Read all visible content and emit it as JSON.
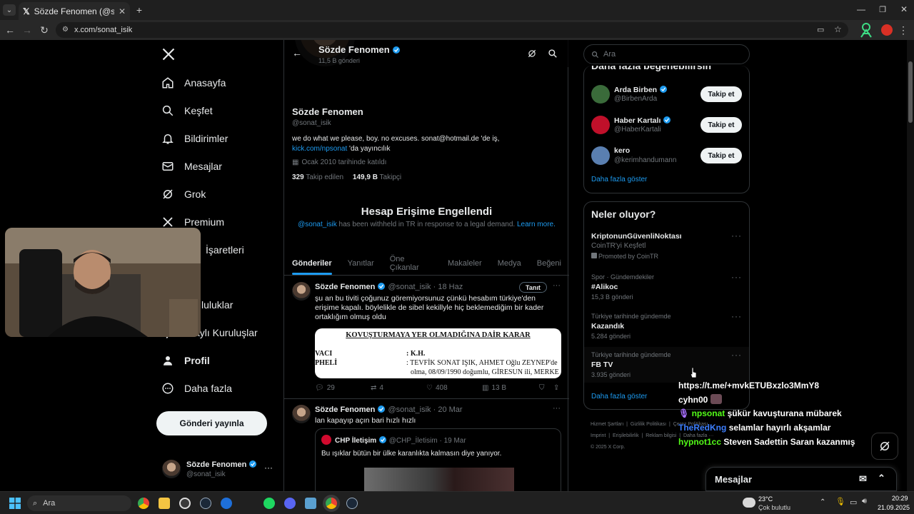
{
  "browser": {
    "tab_title": "Sözde Fenomen (@sonat_isik) /",
    "url": "x.com/sonat_isik"
  },
  "nav": {
    "items": [
      {
        "label": "Anasayfa",
        "icon": "home-icon"
      },
      {
        "label": "Keşfet",
        "icon": "search-icon"
      },
      {
        "label": "Bildirimler",
        "icon": "bell-icon"
      },
      {
        "label": "Mesajlar",
        "icon": "mail-icon"
      },
      {
        "label": "Grok",
        "icon": "grok-icon"
      },
      {
        "label": "Premium",
        "icon": "x-logo-icon"
      },
      {
        "label": "İşaretleri",
        "icon": "bookmark-icon"
      },
      {
        "label": "luluklar",
        "icon": "community-icon"
      },
      {
        "label": "aylı Kuruluşlar",
        "icon": "lightning-icon"
      },
      {
        "label": "Profil",
        "icon": "person-icon"
      },
      {
        "label": "Daha fazla",
        "icon": "more-circle-icon"
      }
    ],
    "post_button": "Gönderi yayınla",
    "account_name": "Sözde Fenomen",
    "account_handle": "@sonat_isik",
    "account_more": "···"
  },
  "profile": {
    "header_name": "Sözde Fenomen",
    "header_posts": "11,5 B gönderi",
    "name": "Sözde Fenomen",
    "handle": "@sonat_isik",
    "bio_line1": "we do what we please, boy. no excuses.  sonat@hotmail.de 'de iş,",
    "bio_link": "kick.com/npsonat",
    "bio_line2_rest": " 'da yayıncılık",
    "joined": "Ocak 2010 tarihinde katıldı",
    "following_count": "329",
    "following_label": "Takip edilen",
    "followers_count": "149,9 B",
    "followers_label": "Takipçi",
    "withheld_title": "Hesap Erişime Engellendi",
    "withheld_handle": "@sonat_isik",
    "withheld_text": " has been withheld in TR in response to a legal demand. ",
    "withheld_link": "Learn more."
  },
  "tabs": [
    "Gönderiler",
    "Yanıtlar",
    "Öne Çıkanlar",
    "Makaleler",
    "Medya",
    "Beğeni"
  ],
  "tweets": [
    {
      "name": "Sözde Fenomen",
      "handle": "@sonat_isik",
      "date": "· 18 Haz",
      "translate": "Tanıt",
      "more": "···",
      "text": "şu an bu tiviti çoğunuz göremiyorsunuz çünkü hesabım türkiye'den erişime kapalı. böylelikle de sibel kekillyle hiç beklemediğim bir kader ortaklığım olmuş oldu",
      "doc_title": "KOVUŞTURMAYA YER OLMADIĞINA DAİR KARAR",
      "doc_row1_label": "VACI",
      "doc_row1_value": ": K.H.",
      "doc_row2_label": "PHELİ",
      "doc_row2_value": ": TEVFİK SONAT IŞIK, AHMET Oğlu ZEYNEP'de",
      "doc_row3_value": "olma, 08/09/1990 doğumlu, GİRESUN ili, MERKE",
      "replies": "29",
      "reposts": "4",
      "likes": "408",
      "views": "13 B"
    },
    {
      "name": "Sözde Fenomen",
      "handle": "@sonat_isik",
      "date": "· 20 Mar",
      "more": "···",
      "text": "lan kapayıp açın bari hızlı hızlı",
      "quote_name": "CHP İletişim",
      "quote_handle": "@CHP_İletisim",
      "quote_date": "· 19 Mar",
      "quote_text": "Bu ışıklar bütün bir ülke karanlıkta kalmasın diye yanıyor."
    }
  ],
  "right": {
    "search_placeholder": "Ara",
    "who_title": "Daha fazla beğenebilirsin",
    "suggestions": [
      {
        "name": "Arda Birben",
        "handle": "@BirbenArda",
        "button": "Takip et",
        "color": "#3a6b3a"
      },
      {
        "name": "Haber Kartalı",
        "handle": "@HaberKartali",
        "button": "Takip et",
        "color": "#c0102a"
      },
      {
        "name": "kero",
        "handle": "@kerimhandumann",
        "button": "Takip et",
        "color": "#5a7fb0"
      }
    ],
    "show_more": "Daha fazla göster",
    "trends_title": "Neler oluyor?",
    "trends": [
      {
        "name": "KriptonunGüvenliNoktası",
        "meta": "CoinTR'yi Keşfetl",
        "sub": "Promoted by CoinTR"
      },
      {
        "meta": "Spor · Gündemdekiler",
        "name": "#Alikoc",
        "sub": "15,3 B gönderi"
      },
      {
        "meta": "Türkiye tarihinde gündemde",
        "name": "Kazandık",
        "sub": "5.284 gönderi"
      },
      {
        "meta": "Türkiye tarihinde gündemde",
        "name": "FB TV",
        "sub": "3.935 gönderi"
      }
    ],
    "trends_more": "Daha fazla göster",
    "footer_line1": [
      "Hizmet Şartları",
      "Gizlilik Politikası",
      "Çerez Politikası"
    ],
    "footer_line2": [
      "Imprint",
      "Erişilebilirlik",
      "Reklam bilgisi",
      "Daha fazla ···"
    ],
    "footer_copy": "© 2025 X Corp."
  },
  "chat": [
    {
      "user": "",
      "text": "https://t.me/+mvkETUBxzlo3MmY8",
      "color": "#ffffff"
    },
    {
      "user": "cyhn00",
      "text": "",
      "color": "#ffffff"
    },
    {
      "user": "npsonat",
      "text": "şükür kavuşturana mübarek",
      "color": "#53fc18"
    },
    {
      "user": "TheRedKng",
      "text": "selamlar hayırlı akşamlar",
      "color": "#3d7fff"
    },
    {
      "user": "hypnot1cc",
      "text": "Steven Sadettin Saran kazanmış",
      "color": "#53fc18"
    }
  ],
  "messages_dock": "Mesajlar",
  "taskbar": {
    "search": "Ara",
    "weather_temp": "23°C",
    "weather_desc": "Çok bulutlu",
    "time": "20:29",
    "date": "21.09.2025"
  }
}
